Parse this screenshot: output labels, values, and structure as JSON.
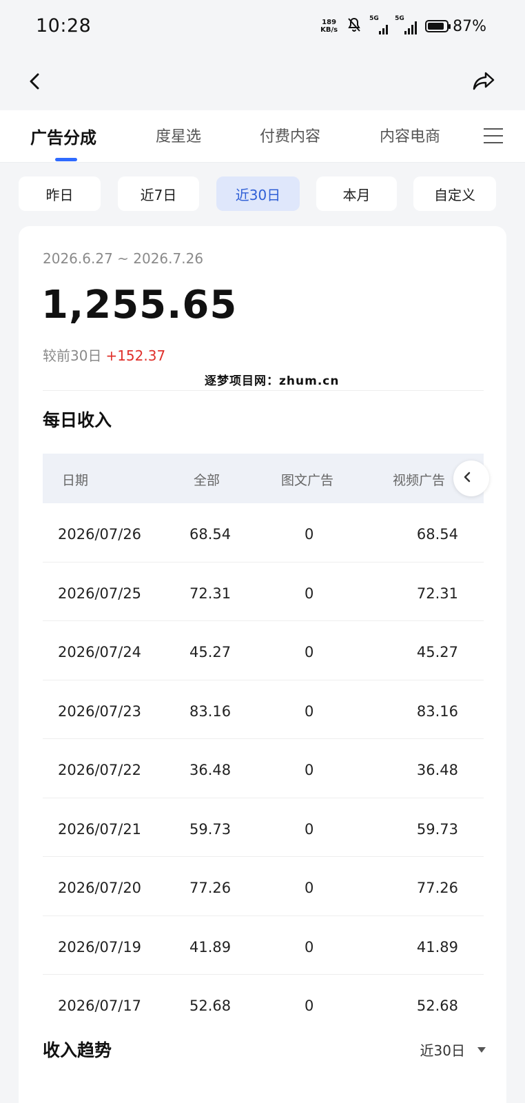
{
  "status_bar": {
    "time": "10:28",
    "net_speed_value": "189",
    "net_speed_unit": "KB/s",
    "signal1_label": "5G",
    "signal2_label": "5G",
    "battery": "87%",
    "battery_level": 0.87,
    "icons": [
      "mute-bell-icon",
      "signal-icon",
      "battery-icon"
    ]
  },
  "nav": {
    "back_icon": "chevron-left-icon",
    "share_icon": "share-icon"
  },
  "tabs": [
    {
      "label": "广告分成",
      "active": true
    },
    {
      "label": "度星选"
    },
    {
      "label": "付费内容"
    },
    {
      "label": "内容电商"
    }
  ],
  "tab_accent": "#2f6bff",
  "ranges": [
    {
      "label": "昨日"
    },
    {
      "label": "近7日"
    },
    {
      "label": "近30日",
      "active": true
    },
    {
      "label": "本月"
    },
    {
      "label": "自定义"
    }
  ],
  "summary": {
    "date_range": "2026.6.27 ~ 2026.7.26",
    "total": "1,255.65",
    "compare_label": "较前30日",
    "compare_delta": "+152.37",
    "watermark": "逐梦项目网：zhum.cn"
  },
  "daily": {
    "title": "每日收入",
    "headers": [
      "日期",
      "全部",
      "图文广告",
      "视频广告"
    ],
    "rows": [
      [
        "2026/07/26",
        "68.54",
        "0",
        "68.54"
      ],
      [
        "2026/07/25",
        "72.31",
        "0",
        "72.31"
      ],
      [
        "2026/07/24",
        "45.27",
        "0",
        "45.27"
      ],
      [
        "2026/07/23",
        "83.16",
        "0",
        "83.16"
      ],
      [
        "2026/07/22",
        "36.48",
        "0",
        "36.48"
      ],
      [
        "2026/07/21",
        "59.73",
        "0",
        "59.73"
      ],
      [
        "2026/07/20",
        "77.26",
        "0",
        "77.26"
      ],
      [
        "2026/07/19",
        "41.89",
        "0",
        "41.89"
      ],
      [
        "2026/07/17",
        "52.68",
        "0",
        "52.68"
      ]
    ]
  },
  "trend": {
    "title": "收入趋势",
    "select_value": "近30日"
  },
  "colors": {
    "positive": "#e0302b",
    "active_range_bg": "#dfe7fb",
    "active_range_text": "#2f5fd6"
  }
}
